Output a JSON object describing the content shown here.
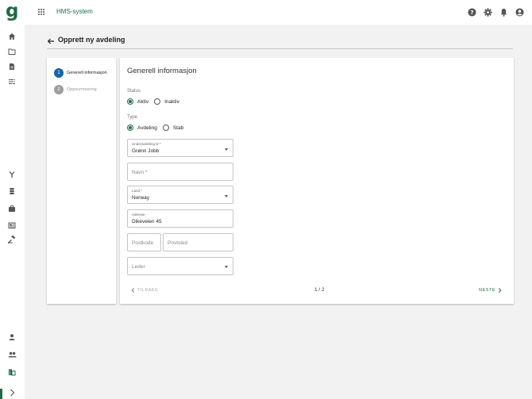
{
  "app": {
    "logo": "g",
    "title": "HMS-system"
  },
  "topbar": {
    "icons": [
      "help-icon",
      "gear-icon",
      "bell-icon",
      "account-icon"
    ]
  },
  "sidebar": {
    "top_items": [
      "home-icon",
      "folder-icon",
      "document-icon",
      "list-icon"
    ],
    "mid_items": [
      "fork-icon",
      "database-icon",
      "briefcase-icon",
      "newspaper-icon",
      "hammer-icon"
    ],
    "bottom_items": [
      "person-icon",
      "group-icon",
      "department-icon",
      "chevron-right-icon"
    ]
  },
  "page": {
    "title": "Opprett ny avdeling"
  },
  "stepper": {
    "steps": [
      {
        "number": "1",
        "label": "Generell informasjon",
        "active": true
      },
      {
        "number": "2",
        "label": "Oppsummering",
        "active": false
      }
    ]
  },
  "form": {
    "title": "Generell informasjon",
    "status": {
      "label": "Status",
      "options": [
        "Aktiv",
        "Inaktiv"
      ],
      "selected": "Aktiv"
    },
    "type": {
      "label": "Type",
      "options": [
        "Avdeling",
        "Stab"
      ],
      "selected": "Avdeling"
    },
    "underavdeling": {
      "label": "Underavdeling til *",
      "value": "Grønn Jobb"
    },
    "navn": {
      "placeholder": "Navn *"
    },
    "land": {
      "label": "Land *",
      "value": "Norway"
    },
    "adresse": {
      "label": "Adresse",
      "value": "Dikeveien 45"
    },
    "postkode": {
      "placeholder": "Postkode"
    },
    "poststed": {
      "placeholder": "Poststed"
    },
    "leder": {
      "placeholder": "Leder"
    }
  },
  "footer": {
    "back_label": "TILBAKE",
    "page_indicator": "1 / 2",
    "next_label": "NESTE"
  },
  "colors": {
    "brand": "#1f6b45",
    "step_active": "#1565a6",
    "step_inactive": "#9e9e9e"
  }
}
